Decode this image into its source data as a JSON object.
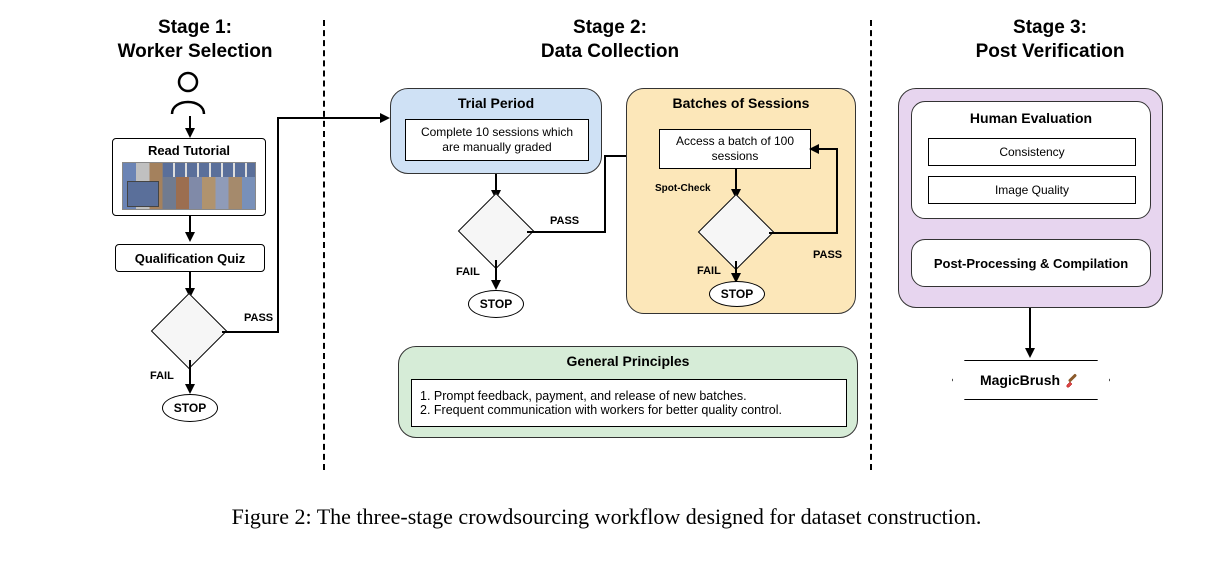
{
  "caption": "Figure 2: The three-stage crowdsourcing workflow designed for dataset construction.",
  "stages": {
    "s1": {
      "title": "Stage 1:\nWorker Selection"
    },
    "s2": {
      "title": "Stage 2:\nData Collection"
    },
    "s3": {
      "title": "Stage 3:\nPost Verification"
    }
  },
  "stage1": {
    "read_tutorial": "Read Tutorial",
    "qualification_quiz": "Qualification Quiz",
    "fail": "FAIL",
    "pass": "PASS",
    "stop": "STOP"
  },
  "stage2": {
    "trial": {
      "title": "Trial Period",
      "desc": "Complete 10 sessions which are manually graded",
      "fail": "FAIL",
      "pass": "PASS",
      "stop": "STOP"
    },
    "batches": {
      "title": "Batches of Sessions",
      "desc": "Access a batch of 100 sessions",
      "spot_check": "Spot-Check",
      "fail": "FAIL",
      "pass": "PASS",
      "stop": "STOP"
    },
    "principles": {
      "title": "General Principles",
      "line1": "1. Prompt feedback, payment, and release of new batches.",
      "line2": "2. Frequent communication with workers for better quality control."
    }
  },
  "stage3": {
    "human_eval": {
      "title": "Human Evaluation",
      "consistency": "Consistency",
      "quality": "Image Quality"
    },
    "post_proc": "Post-Processing & Compilation",
    "output": "MagicBrush"
  },
  "colors": {
    "trial_bg": "#cfe1f5",
    "batches_bg": "#fce7b9",
    "principles_bg": "#d6ecd7",
    "stage3_bg": "#e7d5ef"
  }
}
